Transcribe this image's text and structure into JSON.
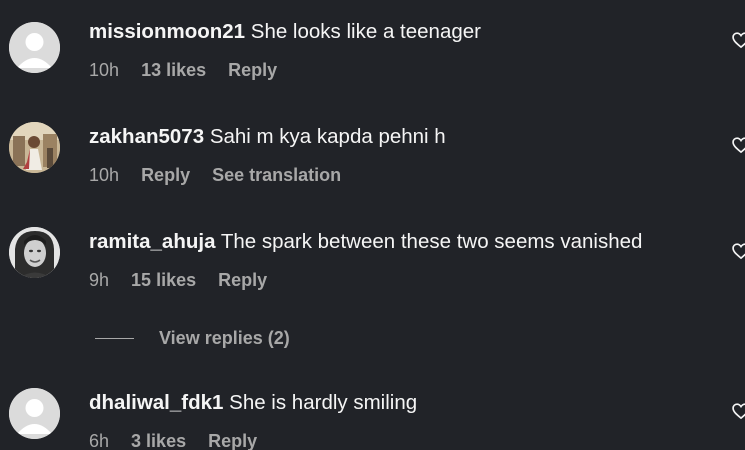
{
  "comments": [
    {
      "username": "missionmoon21",
      "text": "She looks like a teenager",
      "time": "10h",
      "likes": "13 likes",
      "reply": "Reply",
      "avatar": "default-avatar-icon"
    },
    {
      "username": "zakhan5073",
      "text": "Sahi m kya kapda pehni h",
      "time": "10h",
      "reply": "Reply",
      "translation": "See translation",
      "avatar": "user-photo"
    },
    {
      "username": "ramita_ahuja",
      "text": "The spark between these two seems vanished",
      "time": "9h",
      "likes": "15 likes",
      "reply": "Reply",
      "avatar": "user-photo"
    },
    {
      "username": "dhaliwal_fdk1",
      "text": "She is hardly smiling",
      "time": "6h",
      "likes": "3 likes",
      "reply": "Reply",
      "avatar": "default-avatar-icon"
    }
  ],
  "view_replies": "View replies (2)",
  "colors": {
    "background": "#212328",
    "primary_text": "#f5f5f5",
    "secondary_text": "#a8a8a8",
    "default_avatar_bg": "#dbdbdb"
  }
}
